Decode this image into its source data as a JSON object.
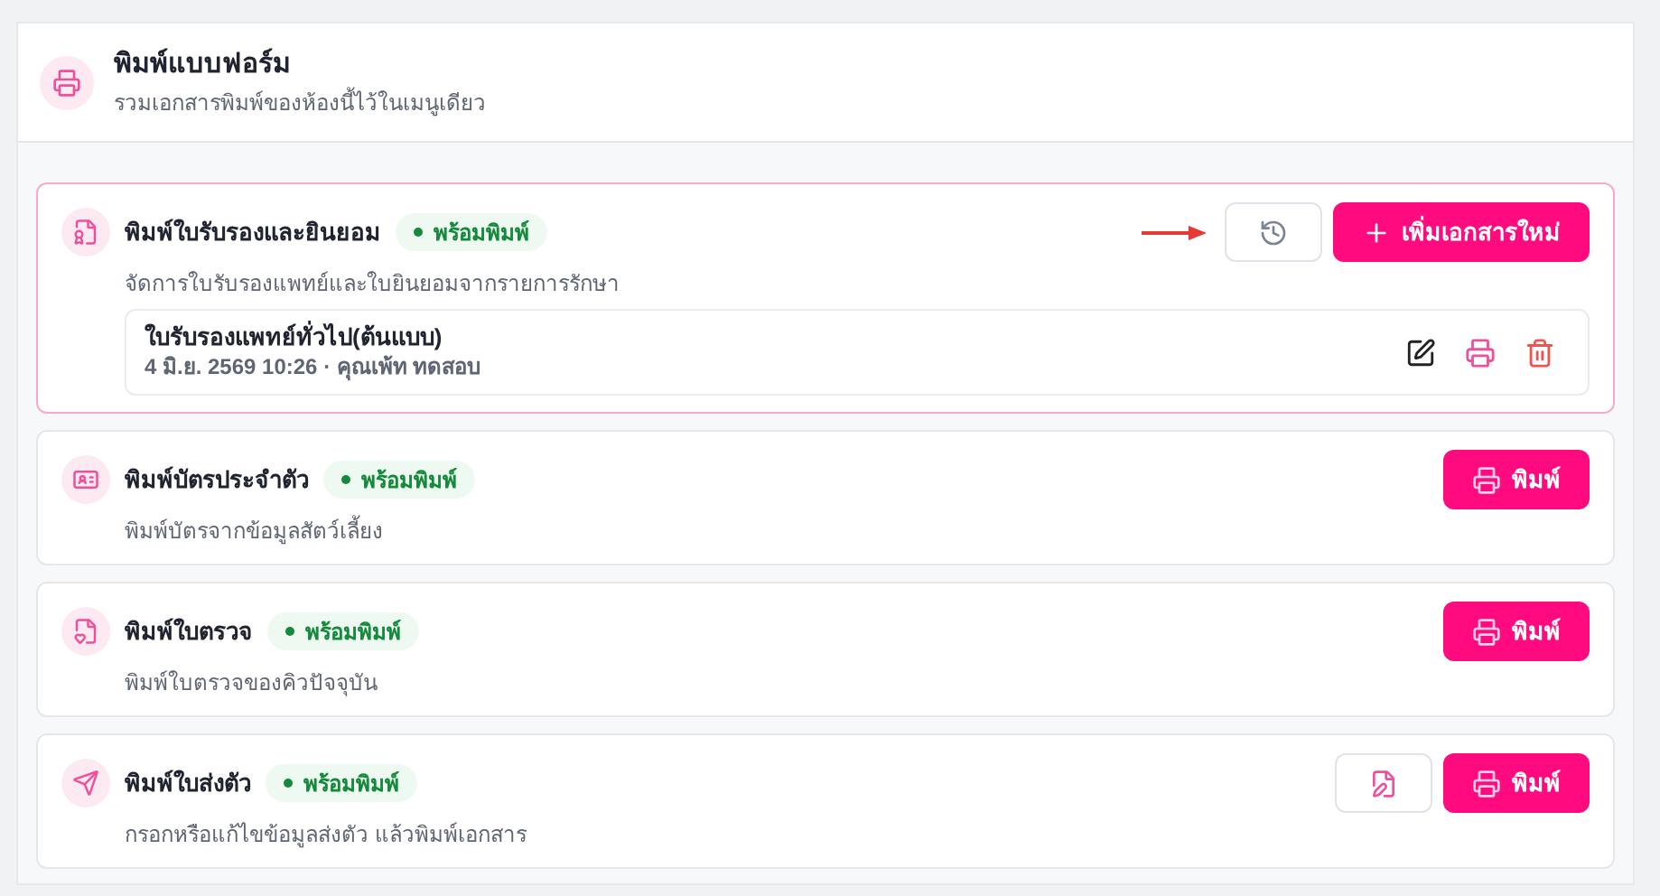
{
  "header": {
    "title": "พิมพ์แบบฟอร์ม",
    "subtitle": "รวมเอกสารพิมพ์ของห้องนี้ไว้ในเมนูเดียว"
  },
  "forms": [
    {
      "kind": "certificate",
      "highlighted": true,
      "title": "พิมพ์ใบรับรองและยินยอม",
      "status": "พร้อมพิมพ์",
      "description": "จัดการใบรับรองแพทย์และใบยินยอมจากรายการรักษา",
      "pointer": true,
      "actions": [
        {
          "kind": "history"
        },
        {
          "kind": "add",
          "label": "เพิ่มเอกสารใหม่"
        }
      ],
      "documents": [
        {
          "name": "ใบรับรองแพทย์ทั่วไป(ต้นแบบ)",
          "meta": "4 มิ.ย. 2569 10:26 · คุณเพ้ท ทดสอบ"
        }
      ]
    },
    {
      "kind": "id_card",
      "highlighted": false,
      "title": "พิมพ์บัตรประจำตัว",
      "status": "พร้อมพิมพ์",
      "description": "พิมพ์บัตรจากข้อมูลสัตว์เลี้ยง",
      "pointer": false,
      "actions": [
        {
          "kind": "print",
          "label": "พิมพ์"
        }
      ]
    },
    {
      "kind": "exam",
      "highlighted": false,
      "title": "พิมพ์ใบตรวจ",
      "status": "พร้อมพิมพ์",
      "description": "พิมพ์ใบตรวจของคิวปัจจุบัน",
      "pointer": false,
      "actions": [
        {
          "kind": "print",
          "label": "พิมพ์"
        }
      ]
    },
    {
      "kind": "referral",
      "highlighted": false,
      "title": "พิมพ์ใบส่งตัว",
      "status": "พร้อมพิมพ์",
      "description": "กรอกหรือแก้ไขข้อมูลส่งตัว แล้วพิมพ์เอกสาร",
      "pointer": false,
      "actions": [
        {
          "kind": "edit"
        },
        {
          "kind": "print",
          "label": "พิมพ์"
        }
      ]
    }
  ]
}
